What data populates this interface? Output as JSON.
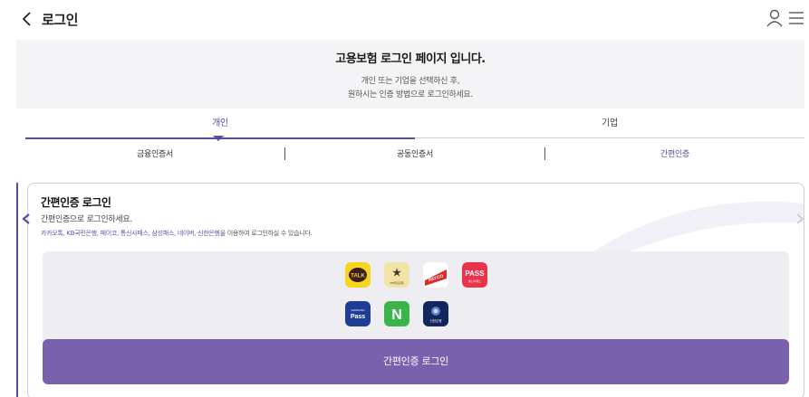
{
  "header": {
    "title": "로그인"
  },
  "banner": {
    "title": "고용보험 로그인 페이지 입니다.",
    "desc_line1": "개인 또는 기업을 선택하신 후,",
    "desc_line2": "원하시는 인증 방법으로 로그인하세요."
  },
  "tabs": {
    "personal": "개인",
    "company": "기업"
  },
  "subtabs": {
    "finance": "금융인증서",
    "joint": "공동인증서",
    "simple": "간편인증"
  },
  "card": {
    "title": "간편인증 로그인",
    "subtitle": "간편인증으로 로그인하세요.",
    "providers_highlight": "카카오톡, KB국민은행, 페이코, 통신사패스, 삼성패스, 네이버, 신한은행",
    "providers_suffix": "을 이용하여 로그인하실 수 있습니다."
  },
  "logos": {
    "talk": "TALK",
    "kb_sub": "KB국민은행",
    "payco": "PAYCO",
    "pass": "PASS",
    "pass_sub": "통신사패스",
    "samsung_small": "SAMSUNG",
    "samsung_pass": "Pass",
    "naver": "N",
    "shinhan": "신한은행"
  },
  "login_button": "간편인증 로그인",
  "colors": {
    "accent": "#5e4a9a",
    "button": "#7a61ad",
    "banner_bg": "#f4f4f6"
  }
}
